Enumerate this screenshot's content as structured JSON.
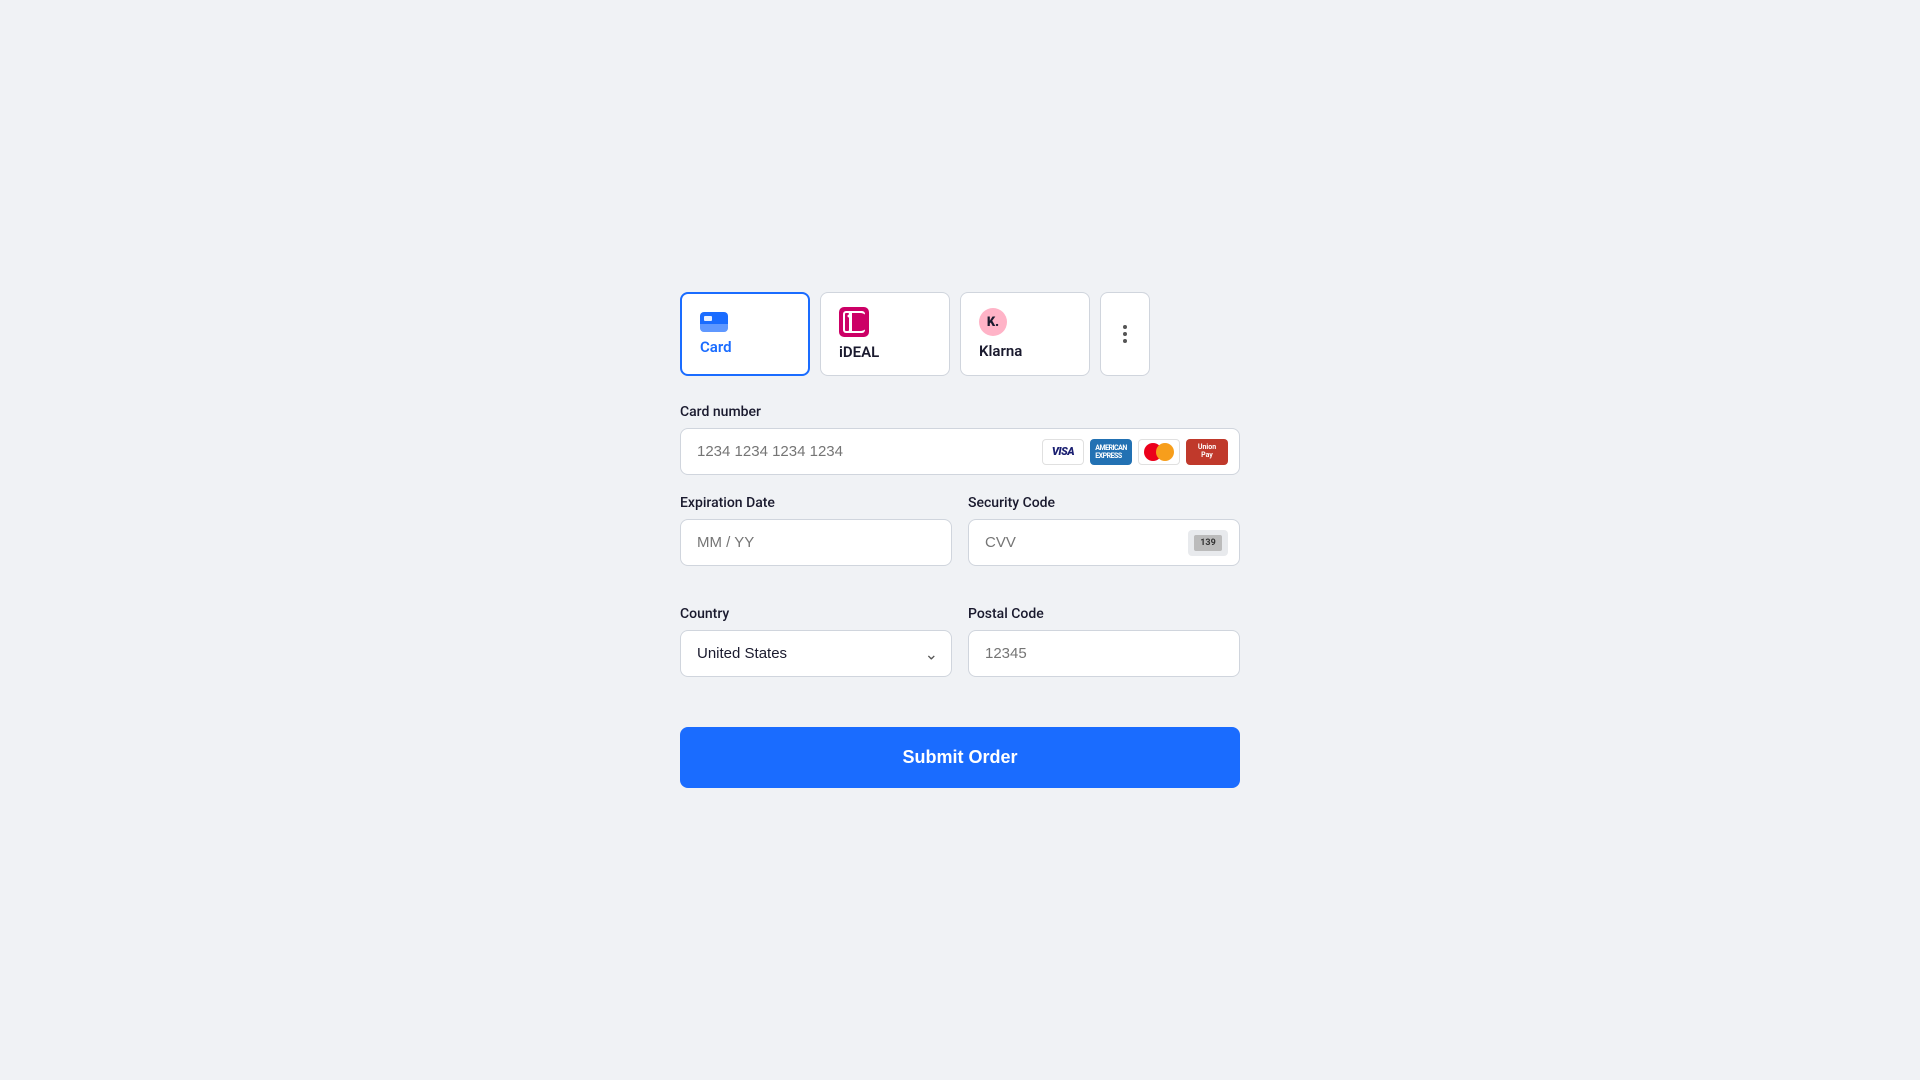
{
  "tabs": [
    {
      "id": "card",
      "label": "Card",
      "icon": "credit-card-icon",
      "active": true
    },
    {
      "id": "ideal",
      "label": "iDEAL",
      "icon": "ideal-icon",
      "active": false
    },
    {
      "id": "klarna",
      "label": "Klarna",
      "icon": "klarna-icon",
      "active": false
    },
    {
      "id": "more",
      "label": "",
      "icon": "more-icon",
      "active": false
    }
  ],
  "form": {
    "card_number_label": "Card number",
    "card_number_placeholder": "1234 1234 1234 1234",
    "expiration_label": "Expiration Date",
    "expiration_placeholder": "MM / YY",
    "security_label": "Security Code",
    "security_placeholder": "CVV",
    "country_label": "Country",
    "country_value": "United States",
    "postal_label": "Postal Code",
    "postal_placeholder": "12345"
  },
  "submit_label": "Submit Order",
  "colors": {
    "active_tab_border": "#1a6cff",
    "active_tab_label": "#1a6cff",
    "submit_bg": "#1a6cff",
    "card_icon_bg": "#1a6cff"
  }
}
